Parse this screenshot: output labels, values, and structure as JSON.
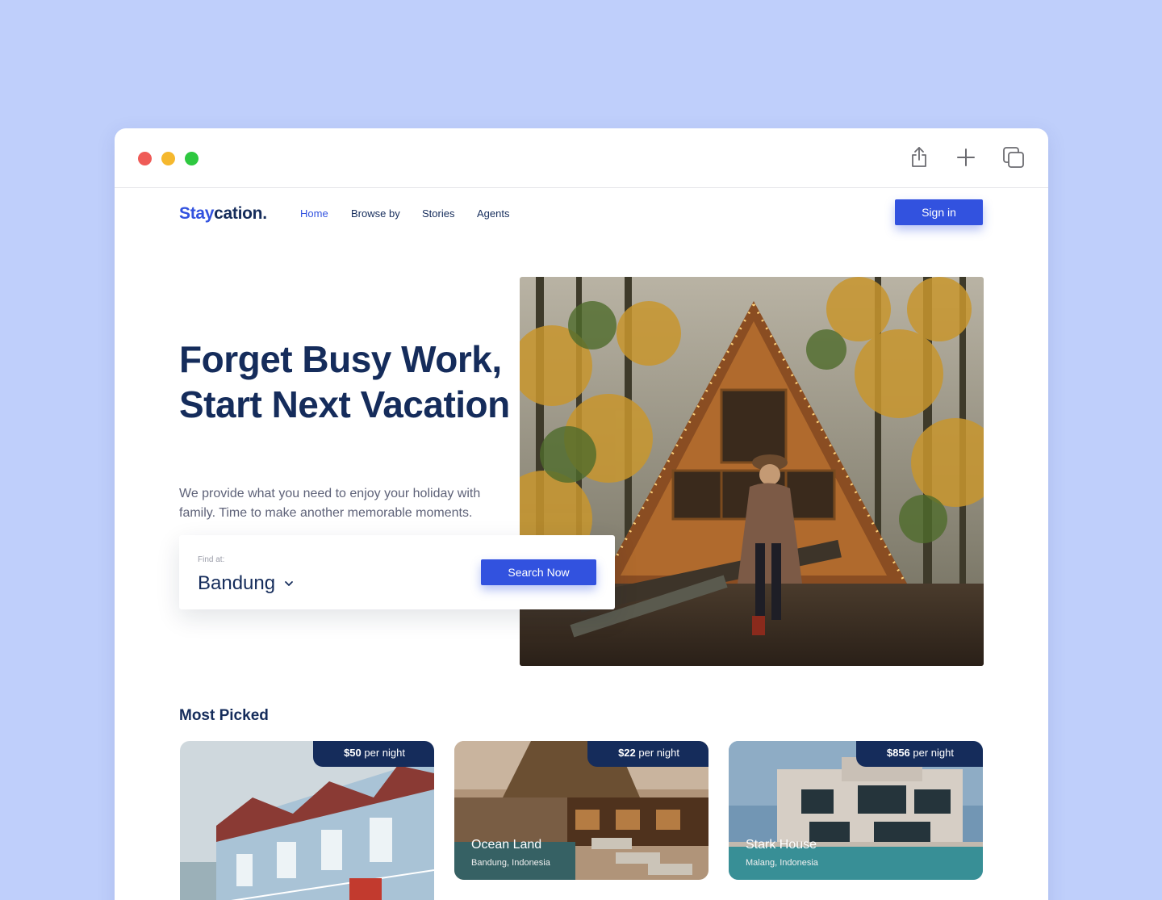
{
  "window": {
    "toolbar_icons": [
      "share-icon",
      "plus-icon",
      "tabs-icon"
    ]
  },
  "nav": {
    "logo_accent": "Stay",
    "logo_rest": "cation.",
    "links": [
      "Home",
      "Browse by",
      "Stories",
      "Agents"
    ],
    "active_link": "Home",
    "signin_label": "Sign in"
  },
  "hero": {
    "title": "Forget Busy Work, Start Next Vacation",
    "subtitle": "We provide what you need to enjoy your  holiday with family. Time to make another memorable moments."
  },
  "search": {
    "find_label": "Find at:",
    "location": "Bandung",
    "button_label": "Search Now"
  },
  "most_picked": {
    "title": "Most Picked",
    "cards": [
      {
        "price": "$50",
        "unit": "per night",
        "name": "",
        "location": ""
      },
      {
        "price": "$22",
        "unit": "per night",
        "name": "Ocean Land",
        "location": "Bandung, Indonesia"
      },
      {
        "price": "$856",
        "unit": "per night",
        "name": "Stark House",
        "location": "Malang, Indonesia"
      }
    ]
  },
  "colors": {
    "primary": "#3252df",
    "navy": "#152c5b",
    "background": "#bfcffb"
  }
}
